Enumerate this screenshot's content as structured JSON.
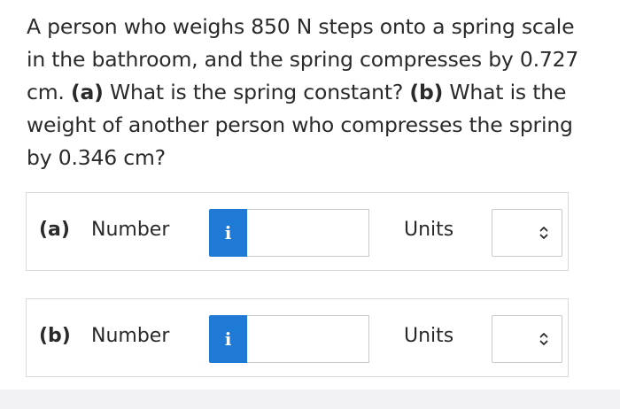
{
  "question": {
    "text_1": "A person who weighs 850 N steps onto a spring scale in the bathroom, and the spring compresses by 0.727 cm. ",
    "part_a_tag": "(a)",
    "text_2": " What is the spring constant? ",
    "part_b_tag": "(b)",
    "text_3": " What is the weight of another person who compresses the spring by 0.346 cm?"
  },
  "rows": [
    {
      "part_label": "(a)",
      "number_label": "Number",
      "info_icon_glyph": "i",
      "number_value": "",
      "units_label": "Units",
      "units_selected": ""
    },
    {
      "part_label": "(b)",
      "number_label": "Number",
      "info_icon_glyph": "i",
      "number_value": "",
      "units_label": "Units",
      "units_selected": ""
    }
  ],
  "icons": {
    "info": "info-icon",
    "select_arrows": "chevron-up-down-icon"
  },
  "colors": {
    "info_button": "#1f7ad6",
    "text": "#2a2a2a",
    "border": "#d9d9dc"
  }
}
